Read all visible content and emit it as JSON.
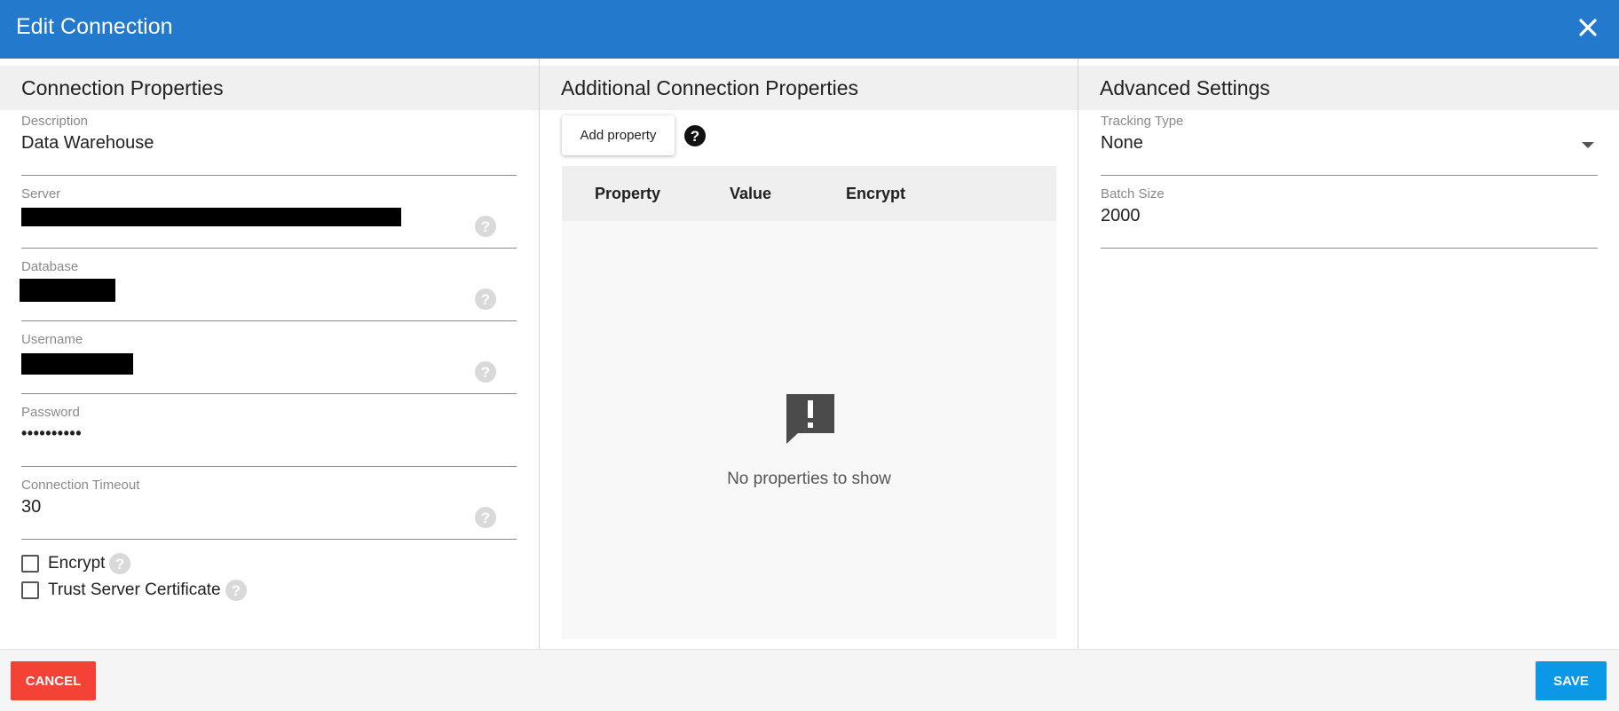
{
  "dialog": {
    "title": "Edit Connection",
    "header_color": "#2379cc"
  },
  "connection_properties": {
    "header": "Connection Properties",
    "fields": [
      {
        "label": "Description",
        "value": "Data Warehouse"
      },
      {
        "label": "Server",
        "value": ""
      },
      {
        "label": "Database",
        "value": ""
      },
      {
        "label": "Username",
        "value": ""
      },
      {
        "label": "Password",
        "value": "••••••••••"
      },
      {
        "label": "Connection Timeout",
        "value": "30"
      }
    ],
    "checkboxes": [
      {
        "label": "Encrypt",
        "checked": false
      },
      {
        "label": "Trust Server Certificate",
        "checked": false
      }
    ]
  },
  "additional_properties": {
    "header": "Additional Connection Properties",
    "add_button": "Add property",
    "columns": [
      "Property",
      "Value",
      "Encrypt"
    ],
    "empty_message": "No properties to show"
  },
  "advanced_settings": {
    "header": "Advanced Settings",
    "tracking_type": {
      "label": "Tracking Type",
      "value": "None"
    },
    "batch_size": {
      "label": "Batch Size",
      "value": "2000"
    }
  },
  "footer": {
    "cancel_label": "CANCEL",
    "save_label": "SAVE",
    "cancel_color": "#f44336",
    "save_color": "#0b98e7"
  },
  "icons": {
    "close": "close-icon",
    "help": "help-circle-icon",
    "empty": "alert-bubble-icon",
    "dropdown": "caret-down-icon"
  }
}
